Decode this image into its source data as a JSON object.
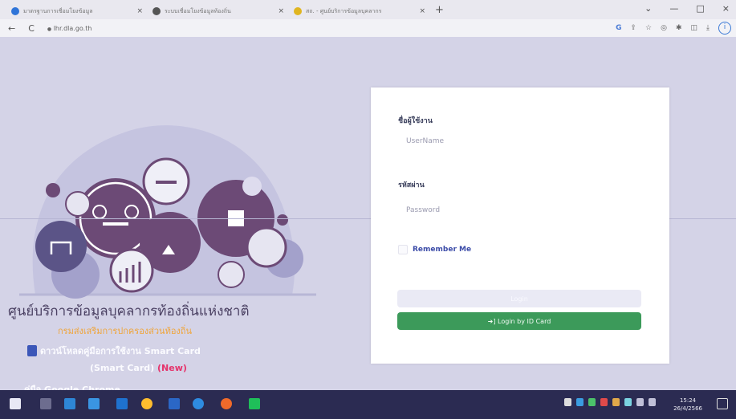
{
  "browser": {
    "tabs": [
      {
        "title": "มาตรฐานการเชื่อมโยงข้อมูล",
        "favicon_color": "#2f74d8"
      },
      {
        "title": "ระบบเชื่อมโยงข้อมูลท้องถิ่น",
        "favicon_color": "#555555"
      },
      {
        "title": "สถ. - ศูนย์บริการข้อมูลบุคลากร",
        "favicon_color": "#e0b520"
      }
    ],
    "tab_close": "×",
    "new_tab": "+",
    "window_controls": {
      "minimize": "—",
      "maximize": "□",
      "close": "×"
    },
    "back": "←",
    "reload": "C",
    "lock": "🔒",
    "url": "lhr.dla.go.th",
    "extension_icons": [
      "G",
      "⇪",
      "☆",
      "◎",
      "✱",
      "◫",
      "⤓"
    ],
    "profile_initial": "i"
  },
  "left": {
    "portal_title": "ศูนย์บริการข้อมูลบุคลากรท้องถิ่นแห่งชาติ",
    "department": "กรมส่งเสริมการปกครองส่วนท้องถิ่น",
    "manual_line1": "ดาวน์โหลดคู่มือการใช้งาน Smart Card",
    "manual_line2": "(Smart Card)",
    "new_badge": "(New)",
    "manual_line3": "คู่มือ Google Chrome"
  },
  "login": {
    "username_label": "ชื่อผู้ใช้งาน",
    "username_placeholder": "UserName",
    "password_label": "รหัสผ่าน",
    "password_placeholder": "Password",
    "remember_label": "Remember Me",
    "login_button": "Login",
    "idcard_button": "Login by ID Card"
  },
  "taskbar": {
    "time": "15:24",
    "date": "26/4/2566",
    "colors": {
      "background": "#2b2b52",
      "accent_green": "#3c9a5a"
    }
  }
}
